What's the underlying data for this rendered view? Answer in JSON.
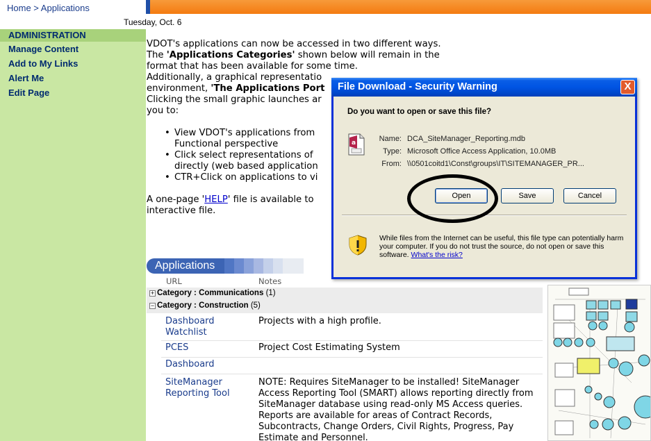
{
  "breadcrumb": {
    "home": "Home",
    "sep": " > ",
    "current": "Applications"
  },
  "date": "Tuesday, Oct. 6",
  "sidebar": {
    "heading": "ADMINISTRATION",
    "items": [
      {
        "label": "Manage Content"
      },
      {
        "label": "Add to My Links"
      },
      {
        "label": "Alert Me"
      },
      {
        "label": "Edit Page"
      }
    ]
  },
  "main": {
    "line1": "VDOT's applications can now be accessed in two different ways.",
    "line2_a": "The ",
    "line2_b": "'Applications Categories'",
    "line2_c": " shown below will remain in the",
    "line3": "format that has been available for some time.",
    "line4": "Additionally, a graphical representatio",
    "line5_a": "environment, ",
    "line5_b": "'The Applications Port",
    "line6": "Clicking the small graphic launches ar",
    "line7": "you to:",
    "bullets": [
      {
        "line1": "View VDOT's applications from",
        "line2": "Functional perspective"
      },
      {
        "line1": "Click select representations of",
        "line2": "directly (web based application"
      },
      {
        "line1": "CTR+Click on applications to vi",
        "line2": ""
      }
    ],
    "help_a": "A one-page '",
    "help_link": "HELP",
    "help_b": "' file is available to",
    "help_line2": "interactive file."
  },
  "apps": {
    "header": "Applications",
    "col_url": "URL",
    "col_notes": "Notes",
    "categories": [
      {
        "toggle": "+",
        "label": "Category : Communications",
        "count": "(1)"
      },
      {
        "toggle": "−",
        "label": "Category : Construction",
        "count": "(5)"
      }
    ],
    "rows": [
      {
        "name": "Dashboard Watchlist",
        "note": "Projects with a high profile."
      },
      {
        "name": "PCES",
        "note": "Project Cost Estimating System"
      },
      {
        "name": "Dashboard",
        "note": ""
      },
      {
        "name": "SiteManager Reporting Tool",
        "note": "NOTE: Requires SiteManager to be installed! SiteManager Access Reporting Tool (SMART) allows reporting directly from SiteManager database using read-only MS Access queries. Reports are available for areas of Contract Records, Subcontracts, Change Orders, Civil Rights, Progress, Pay Estimate and Personnel."
      }
    ]
  },
  "dialog": {
    "title": "File Download - Security Warning",
    "close": "X",
    "question": "Do you want to open or save this file?",
    "name_label": "Name:",
    "name_value": "DCA_SiteManager_Reporting.mdb",
    "type_label": "Type:",
    "type_value": "Microsoft Office Access Application, 10.0MB",
    "from_label": "From:",
    "from_value": "\\\\0501coitd1\\Const\\groups\\IT\\SITEMANAGER_PR...",
    "open": "Open",
    "save": "Save",
    "cancel": "Cancel",
    "warning": "While files from the Internet can be useful, this file type can potentially harm your computer. If you do not trust the source, do not open or save this software. ",
    "risk_link": "What's the risk?"
  },
  "colors": {
    "orange": "#f47b10",
    "sidebar": "#c9e7a3",
    "apps_header": "#3c64b4",
    "xp_title": "#0054e3",
    "link": "#1a3c8c"
  }
}
